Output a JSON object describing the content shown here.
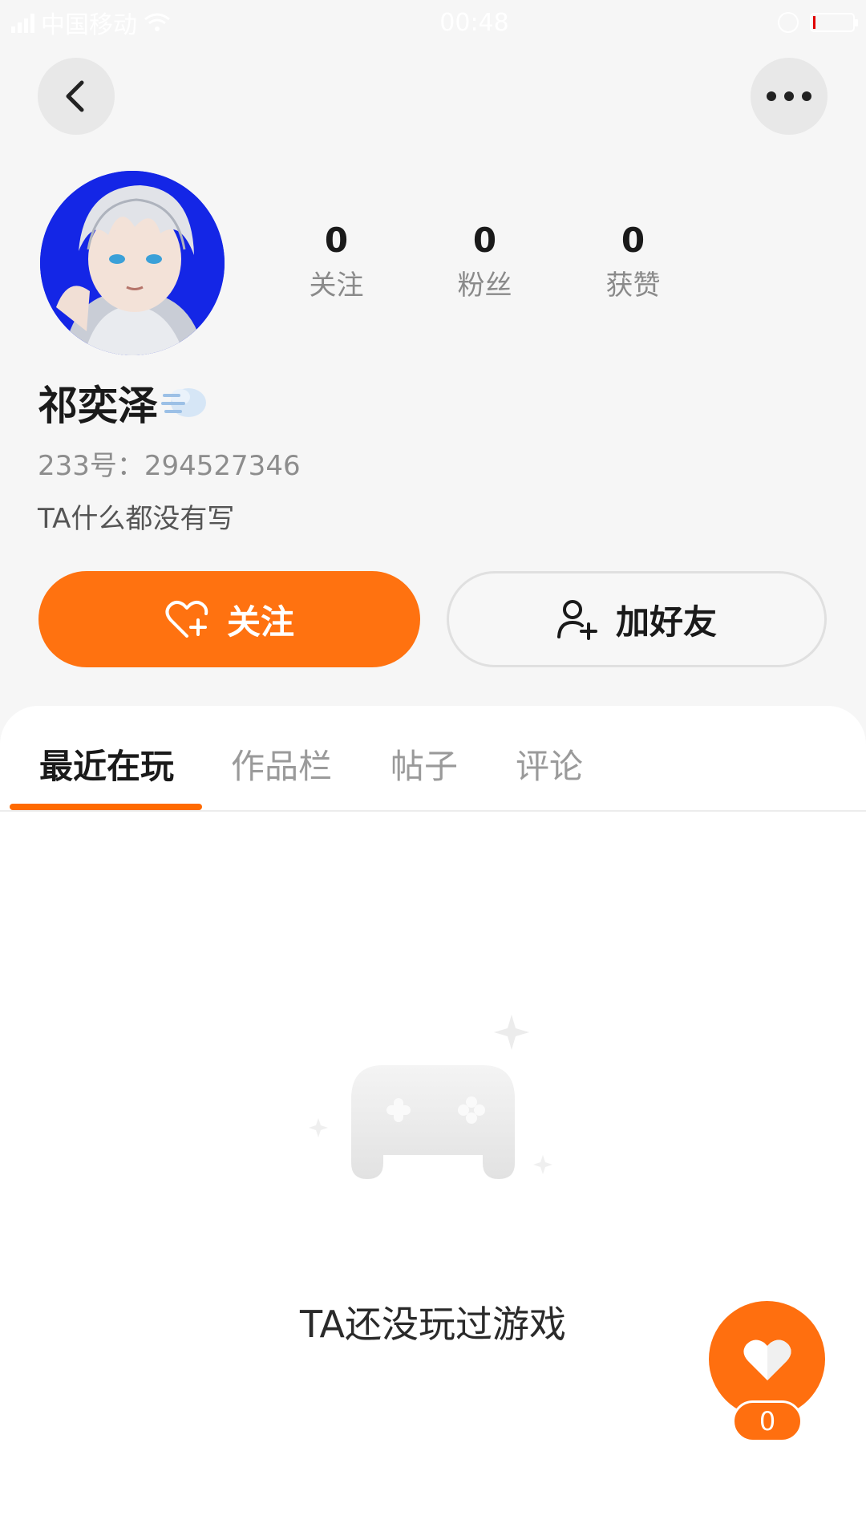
{
  "status_bar": {
    "carrier": "中国移动",
    "time": "00:48"
  },
  "nav": {
    "back_icon": "chevron-left-icon",
    "more_icon": "more-horizontal-icon"
  },
  "profile": {
    "name": "祁奕泽",
    "uid": "233号：294527346",
    "bio": "TA什么都没有写",
    "stats": [
      {
        "value": "0",
        "label": "关注"
      },
      {
        "value": "0",
        "label": "粉丝"
      },
      {
        "value": "0",
        "label": "获赞"
      }
    ]
  },
  "actions": {
    "follow_label": "关注",
    "add_friend_label": "加好友",
    "accent_color": "#ff7210"
  },
  "tabs": [
    {
      "label": "最近在玩",
      "active": true
    },
    {
      "label": "作品栏",
      "active": false
    },
    {
      "label": "帖子",
      "active": false
    },
    {
      "label": "评论",
      "active": false
    }
  ],
  "empty_state": {
    "text": "TA还没玩过游戏",
    "icon": "gamepad-icon"
  },
  "like_fab": {
    "count": "0",
    "icon": "heart-icon"
  }
}
